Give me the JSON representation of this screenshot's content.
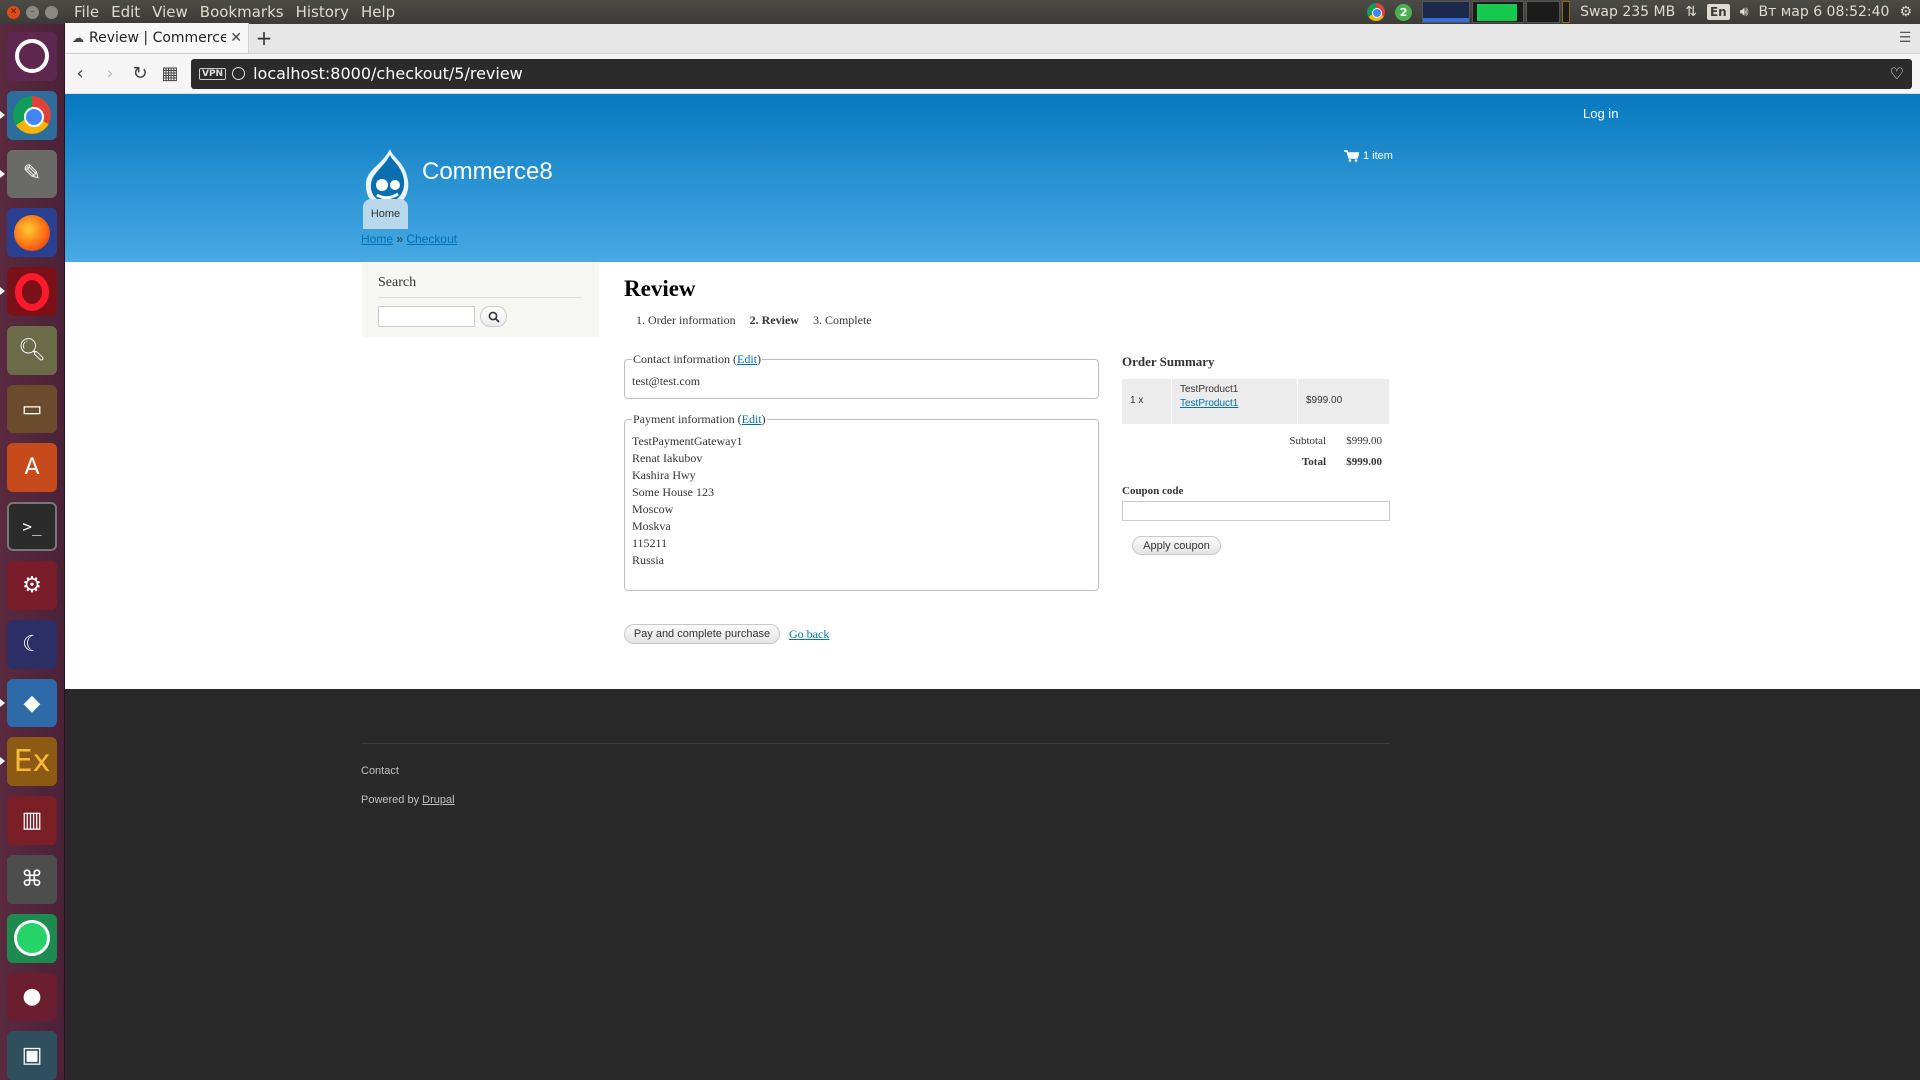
{
  "top_panel": {
    "menu": [
      "File",
      "Edit",
      "View",
      "Bookmarks",
      "History",
      "Help"
    ],
    "badge_count": "2",
    "swap": "Swap 235 MB",
    "lang": "En",
    "datetime": "Вт мар  6 08:52:40"
  },
  "launcher": {
    "items": [
      "ubuntu-dash",
      "chrome",
      "text-editor",
      "firefox",
      "opera",
      "gimp",
      "files",
      "software-center",
      "terminal",
      "system-settings",
      "night-mode",
      "virtualbox",
      "ex-app",
      "book-reader",
      "network-manager",
      "whatsapp",
      "red-app",
      "android-studio"
    ]
  },
  "browser": {
    "tab_title": "Review | Commerce8",
    "url": "localhost:8000/checkout/5/review",
    "vpn_label": "VPN"
  },
  "site": {
    "login": "Log in",
    "name": "Commerce8",
    "cart": "1 item",
    "nav_home": "Home"
  },
  "breadcrumb": {
    "home": "Home",
    "separator": "»",
    "checkout": "Checkout"
  },
  "search_block": {
    "title": "Search",
    "placeholder": ""
  },
  "checkout": {
    "title": "Review",
    "steps": [
      "1. Order information",
      "2. Review",
      "3. Complete"
    ],
    "contact": {
      "legend": "Contact information",
      "edit": "Edit",
      "email": "test@test.com"
    },
    "payment": {
      "legend": "Payment information",
      "edit": "Edit",
      "lines": [
        "TestPaymentGateway1",
        "Renat Iakubov",
        "Kashira Hwy",
        "Some House 123",
        "Moscow",
        "Moskva",
        "115211",
        "Russia"
      ]
    },
    "pay_button": "Pay and complete purchase",
    "go_back": "Go back"
  },
  "order_summary": {
    "title": "Order Summary",
    "items": [
      {
        "qty": "1 x",
        "name": "TestProduct1",
        "link": "TestProduct1",
        "price": "$999.00"
      }
    ],
    "subtotal_label": "Subtotal",
    "subtotal": "$999.00",
    "total_label": "Total",
    "total": "$999.00",
    "coupon_label": "Coupon code",
    "coupon_value": "",
    "apply_button": "Apply coupon"
  },
  "footer": {
    "contact": "Contact",
    "powered_prefix": "Powered by",
    "powered_link": "Drupal"
  },
  "colors": {
    "header_top": "#0779bf",
    "header_bottom": "#48a9e4",
    "link": "#0071b3",
    "footer_bg": "#292929",
    "launcher_bg": "#5a2a3f"
  }
}
